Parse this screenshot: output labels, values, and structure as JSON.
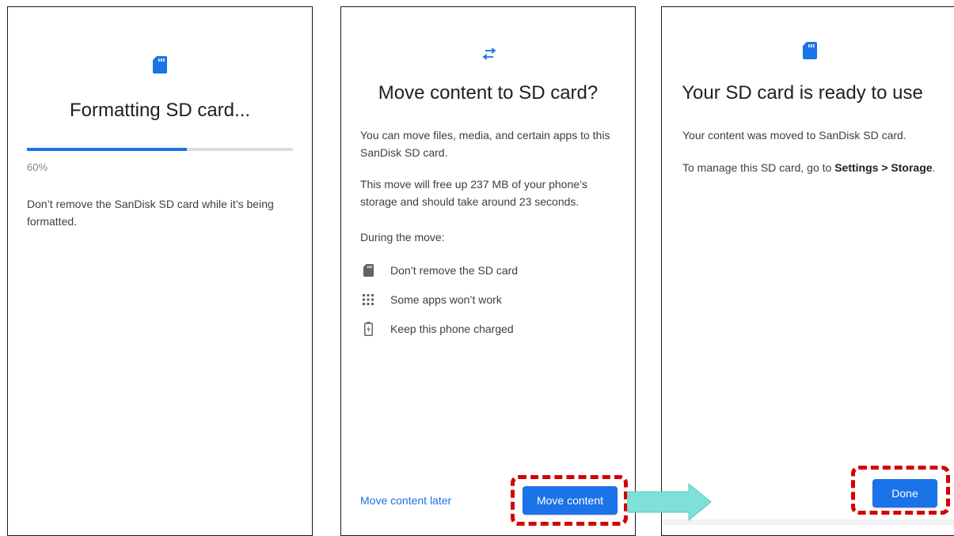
{
  "screens": {
    "formatting": {
      "title": "Formatting SD card...",
      "progress_percent": 60,
      "progress_label": "60%",
      "message": "Don’t remove the SanDisk SD card while it’s being formatted.",
      "icon": "sd-card-icon"
    },
    "move": {
      "title": "Move content to SD card?",
      "paragraph1": "You can move files, media, and certain apps to this SanDisk SD card.",
      "paragraph2": "This move will free up 237 MB of your phone’s storage and should take around 23 seconds.",
      "during_label": "During the move:",
      "items": [
        {
          "icon": "sd-card-icon",
          "label": "Don’t remove the SD card"
        },
        {
          "icon": "apps-grid-icon",
          "label": "Some apps won’t work"
        },
        {
          "icon": "battery-charging-icon",
          "label": "Keep this phone charged"
        }
      ],
      "later_button": "Move content later",
      "move_button": "Move content",
      "icon": "swap-arrows-icon"
    },
    "ready": {
      "title": "Your SD card is ready to use",
      "line1": "Your content was moved to SanDisk SD card.",
      "line2_prefix": "To manage this SD card, go to ",
      "line2_bold": "Settings > Storage",
      "line2_suffix": ".",
      "done_button": "Done",
      "icon": "sd-card-icon"
    }
  },
  "colors": {
    "accent": "#1a73e8",
    "highlight": "#d50000",
    "arrow": "#7fe0d8"
  }
}
